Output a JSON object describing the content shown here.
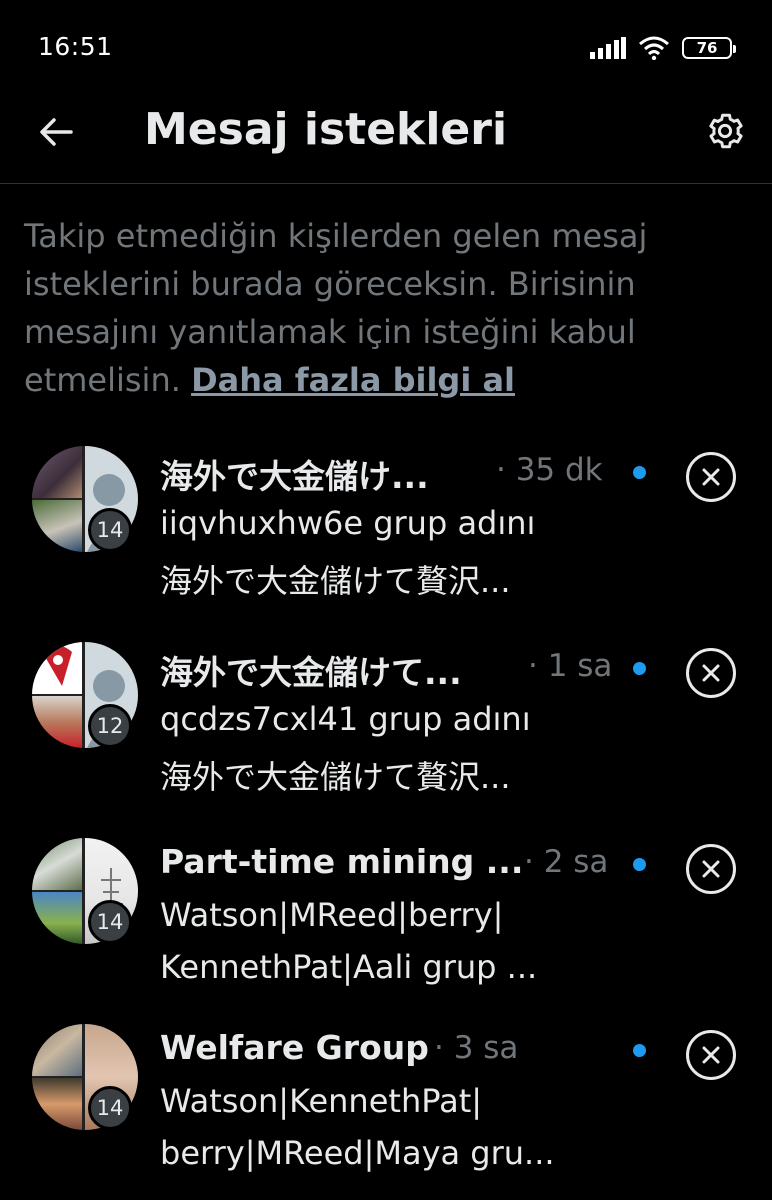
{
  "status_bar": {
    "time": "16:51",
    "battery": "76",
    "icons": [
      "signal-icon",
      "wifi-icon",
      "battery-icon"
    ]
  },
  "header": {
    "title": "Mesaj istekleri",
    "back_icon": "back-arrow-icon",
    "settings_icon": "gear-icon"
  },
  "intro": {
    "text": "Takip etmediğin kişilerden gelen mesaj isteklerini burada göreceksin. Birisinin mesajını yanıtlamak için isteğini kabul etmelisin. ",
    "link": "Daha fazla bilgi al"
  },
  "colors": {
    "background": "#000000",
    "secondary_text": "#71767b",
    "unread_dot": "#1d9bf0",
    "divider": "#2f3336"
  },
  "requests": [
    {
      "name": "海外で大金儲け...",
      "time": "· 35 dk",
      "member_count": "14",
      "preview_line1": "iiqvhuxhw6e grup adını",
      "preview_line2": "海外で大金儲けて贅沢...",
      "unread": true
    },
    {
      "name": "海外で大金儲けて...",
      "time": "· 1 sa",
      "member_count": "12",
      "preview_line1": "qcdzs7cxl41 grup adını",
      "preview_line2": "海外で大金儲けて贅沢...",
      "unread": true
    },
    {
      "name": "Part-time mining ...",
      "time": "· 2 sa",
      "member_count": "14",
      "preview_line1": "Watson|MReed|berry|",
      "preview_line2": "KennethPat|Aali grup ...",
      "unread": true
    },
    {
      "name": "Welfare Group",
      "time": "· 3 sa",
      "member_count": "14",
      "preview_line1": "Watson|KennethPat|",
      "preview_line2": "berry|MReed|Maya gru...",
      "unread": true
    }
  ]
}
